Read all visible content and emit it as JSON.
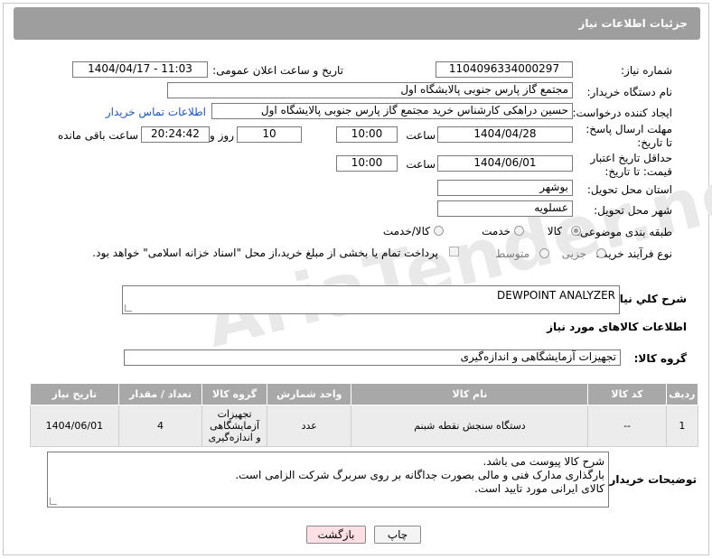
{
  "header": {
    "title": "جزئیات اطلاعات نیاز"
  },
  "fields": {
    "need_number_label": "شماره نیاز:",
    "need_number": "1104096334000297",
    "announce_label": "تاریخ و ساعت اعلان عمومی:",
    "announce_value": "1404/04/17 - 11:03",
    "buyer_org_label": "نام دستگاه خریدار:",
    "buyer_org": "مجتمع گاز پارس جنوبی  پالایشگاه اول",
    "creator_label": "ایجاد کننده درخواست:",
    "creator": "حسین دراهکی کارشناس خرید مجتمع گاز پارس جنوبی  پالایشگاه اول",
    "contact_link": "اطلاعات تماس خریدار",
    "deadline_label": "مهلت ارسال پاسخ: تا تاریخ:",
    "deadline_date": "1404/04/28",
    "time_label": "ساعت",
    "deadline_time": "10:00",
    "days_value": "10",
    "days_label": "روز و",
    "remaining_time": "20:24:42",
    "remaining_label": "ساعت باقی مانده",
    "validity_label": "حداقل تاریخ اعتبار قیمت: تا تاریخ:",
    "validity_date": "1404/06/01",
    "validity_time": "10:00",
    "province_label": "استان محل تحویل:",
    "province": "بوشهر",
    "city_label": "شهر محل تحویل:",
    "city": "عسلویه",
    "category_label": "طبقه بندی موضوعی:",
    "category_options": [
      "کالا",
      "خدمت",
      "کالا/خدمت"
    ],
    "process_label": "نوع فرآیند خرید :",
    "process_options": [
      "جزیی",
      "متوسط"
    ],
    "process_note": "پرداخت تمام یا بخشی از مبلغ خرید،از محل \"اسناد خزانه اسلامی\" خواهد بود.",
    "desc_label": "شرح کلي نياز:",
    "desc_value": "DEWPOINT ANALYZER",
    "items_section": "اطلاعات کالاهای مورد نیاز",
    "group_label": "گروه کالا:",
    "group_value": "تجهیزات آزمایشگاهی و اندازه‌گیری"
  },
  "table": {
    "headers": [
      "ردیف",
      "کد کالا",
      "نام کالا",
      "واحد شمارش",
      "گروه کالا",
      "تعداد / مقدار",
      "تاریخ نیاز"
    ],
    "rows": [
      [
        "1",
        "--",
        "دستگاه سنجش نقطه شبنم",
        "عدد",
        "تجهیزات آزمایشگاهی و اندازه‌گیری",
        "4",
        "1404/06/01"
      ]
    ]
  },
  "notes": {
    "label": "توضیحات خریدار:",
    "lines": [
      "شرح کالا پیوست می باشد.",
      "بارگذاری مدارک فنی و مالی بصورت جداگانه بر روی سربرگ شرکت الزامی است.",
      "کالای ایرانی مورد تایید است."
    ]
  },
  "buttons": {
    "print": "چاپ",
    "back": "بازگشت"
  },
  "colors": {
    "header_bg": "#9e9e9e",
    "link": "#1a56c8",
    "back_btn_bg": "#fde0e6",
    "table_head": "#a8a8a8"
  }
}
